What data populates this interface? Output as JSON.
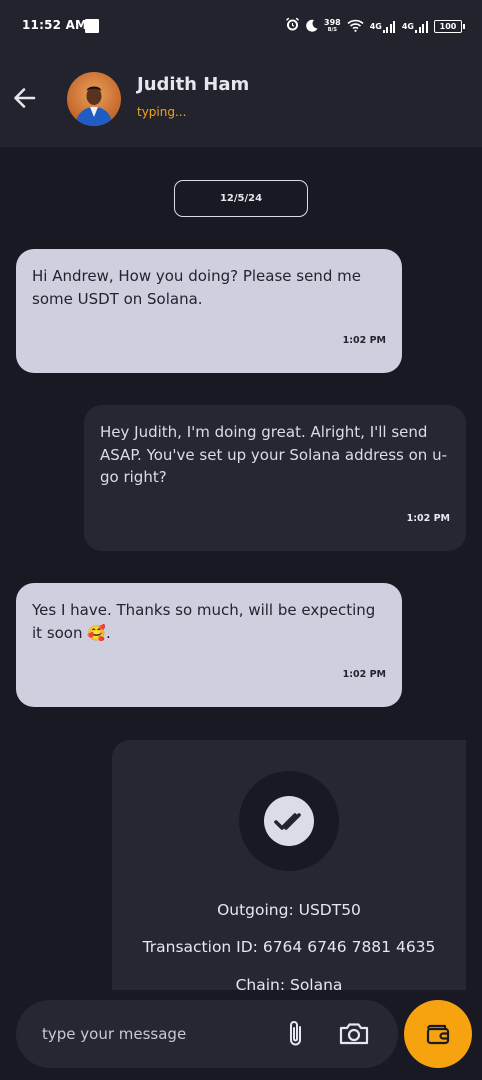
{
  "status_bar": {
    "time": "11:52 AM",
    "speed_value": "398",
    "speed_unit": "B/S",
    "network_1": "4G",
    "network_2": "4G",
    "battery": "100"
  },
  "header": {
    "contact_name": "Judith Ham",
    "contact_status": "typing...",
    "back_icon": "arrow-left-icon"
  },
  "chat": {
    "date": "12/5/24",
    "messages": [
      {
        "direction": "incoming",
        "text": "Hi Andrew, How you doing? Please send me some USDT on Solana.",
        "time": "1:02 PM"
      },
      {
        "direction": "outgoing",
        "text": "Hey Judith, I'm doing great. Alright, I'll send ASAP. You've set up your Solana address on u-go right?",
        "time": "1:02 PM"
      },
      {
        "direction": "incoming",
        "text": "Yes I have. Thanks so much, will be expecting it soon 🥰.",
        "time": "1:02 PM"
      }
    ],
    "transaction": {
      "icon": "double-check-icon",
      "outgoing": "Outgoing: USDT50",
      "transaction_id": "Transaction ID: 6764 6746 7881 4635",
      "chain": "Chain: Solana"
    }
  },
  "composer": {
    "placeholder": "type your message",
    "attach_icon": "paperclip-icon",
    "camera_icon": "camera-icon",
    "wallet_icon": "wallet-icon"
  },
  "colors": {
    "background": "#181922",
    "header": "#22232d",
    "incoming_bubble": "#cfcfe0",
    "outgoing_bubble": "#262733",
    "accent": "#f7a20f",
    "typing": "#f3a417"
  }
}
